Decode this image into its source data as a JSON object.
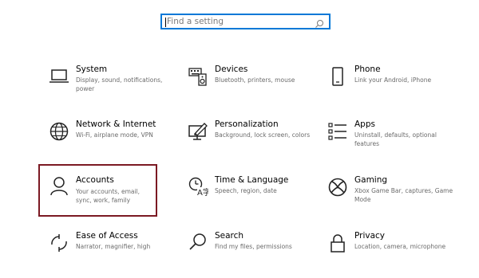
{
  "search": {
    "placeholder": "Find a setting"
  },
  "tiles": [
    {
      "title": "System",
      "desc": "Display, sound, notifications, power"
    },
    {
      "title": "Devices",
      "desc": "Bluetooth, printers, mouse"
    },
    {
      "title": "Phone",
      "desc": "Link your Android, iPhone"
    },
    {
      "title": "Network & Internet",
      "desc": "Wi-Fi, airplane mode, VPN"
    },
    {
      "title": "Personalization",
      "desc": "Background, lock screen, colors"
    },
    {
      "title": "Apps",
      "desc": "Uninstall, defaults, optional features"
    },
    {
      "title": "Accounts",
      "desc": "Your accounts, email, sync, work, family"
    },
    {
      "title": "Time & Language",
      "desc": "Speech, region, date"
    },
    {
      "title": "Gaming",
      "desc": "Xbox Game Bar, captures, Game Mode"
    },
    {
      "title": "Ease of Access",
      "desc": "Narrator, magnifier, high"
    },
    {
      "title": "Search",
      "desc": "Find my files, permissions"
    },
    {
      "title": "Privacy",
      "desc": "Location, camera, microphone"
    }
  ],
  "icons": [
    "laptop-icon",
    "keyboard-speaker-icon",
    "phone-icon",
    "globe-icon",
    "paint-monitor-icon",
    "apps-list-icon",
    "person-icon",
    "time-language-icon",
    "xbox-icon",
    "ease-of-access-icon",
    "search-icon",
    "lock-icon"
  ],
  "colors": {
    "accent": "#0078d7",
    "selected_outline": "#7b1923",
    "desc_text": "#6b6b6b"
  }
}
